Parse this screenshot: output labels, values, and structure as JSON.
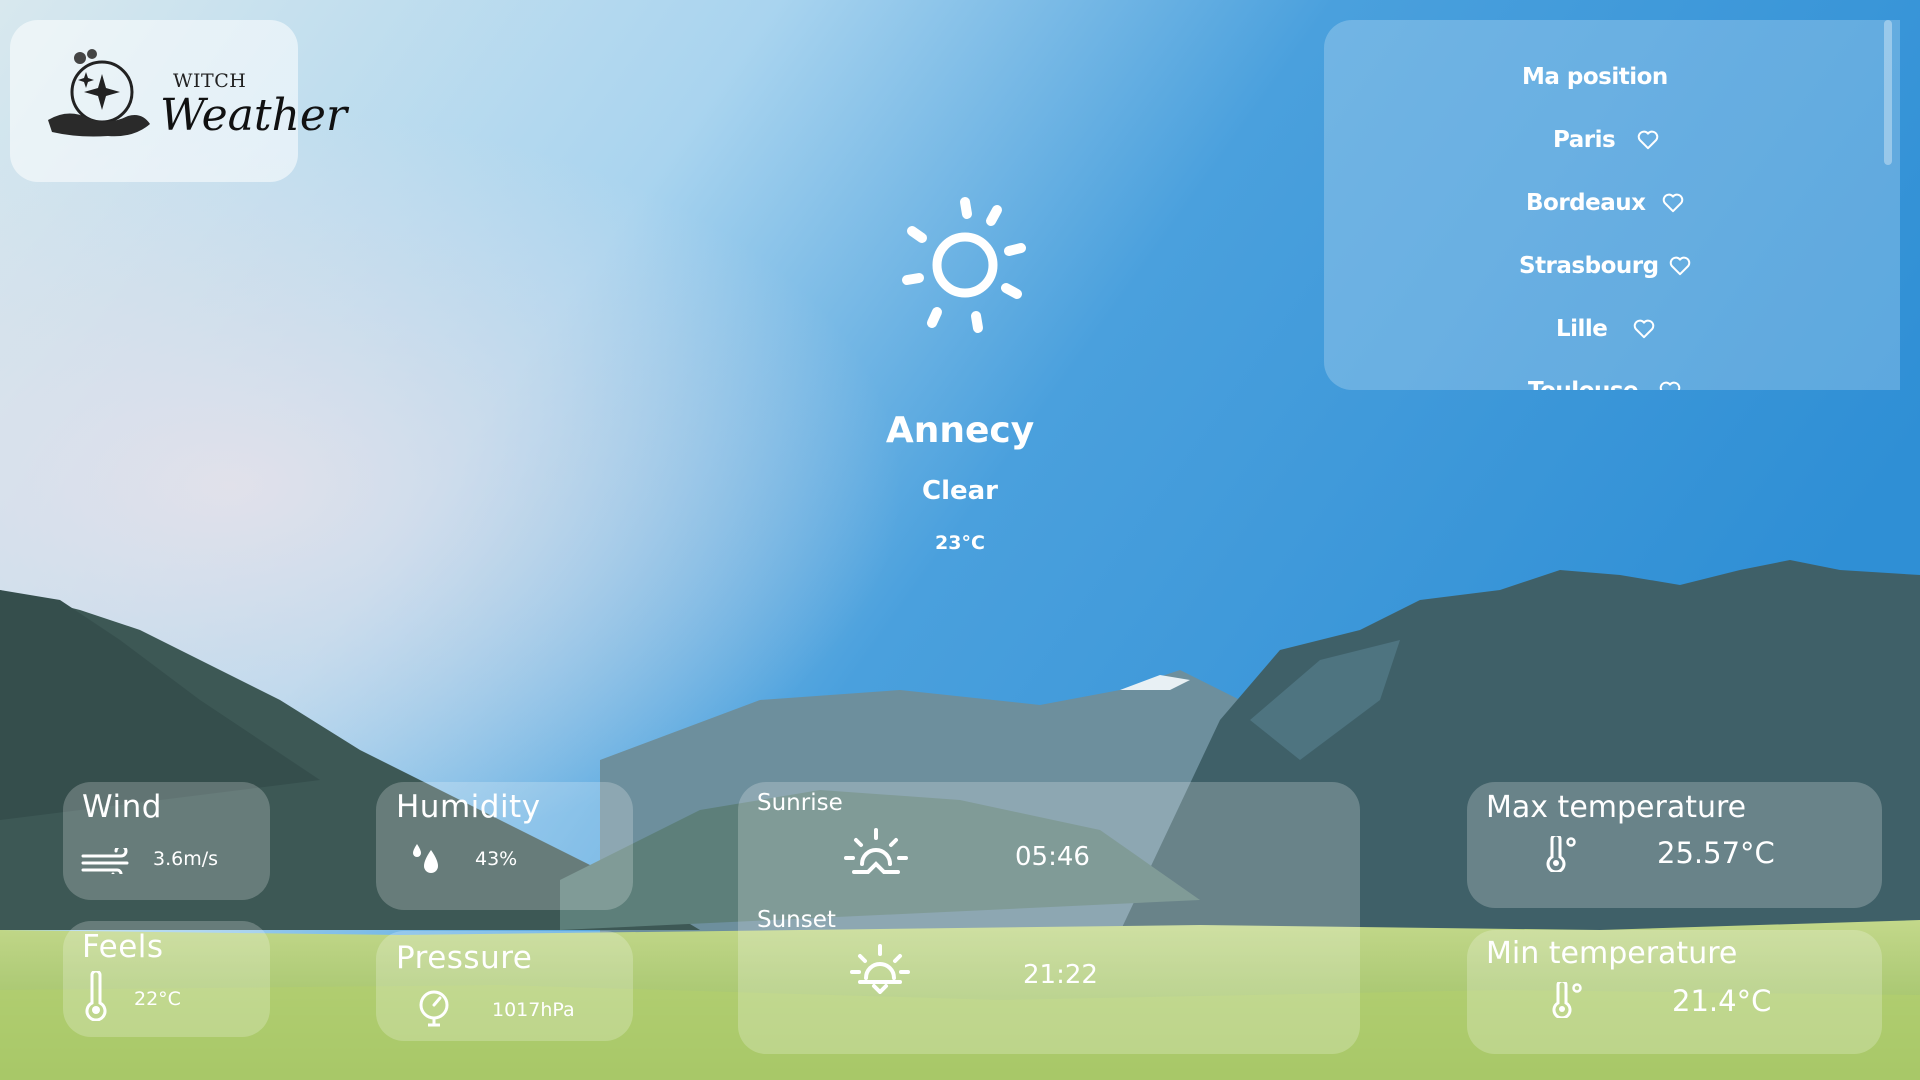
{
  "app": {
    "logo_top": "WITCH",
    "logo_main": "Weather"
  },
  "cities": {
    "items": [
      {
        "label": "Ma position",
        "favorite": false
      },
      {
        "label": "Paris",
        "favorite": true
      },
      {
        "label": "Bordeaux",
        "favorite": true
      },
      {
        "label": "Strasbourg",
        "favorite": true
      },
      {
        "label": "Lille",
        "favorite": true
      },
      {
        "label": "Toulouse",
        "favorite": true
      }
    ]
  },
  "current": {
    "icon": "sun-icon",
    "city": "Annecy",
    "condition": "Clear",
    "temperature": "23°C"
  },
  "cards": {
    "wind": {
      "title": "Wind",
      "value": "3.6m/s",
      "icon": "wind-icon"
    },
    "feels": {
      "title": "Feels",
      "value": "22°C",
      "icon": "thermometer-icon"
    },
    "humidity": {
      "title": "Humidity",
      "value": "43%",
      "icon": "droplets-icon"
    },
    "pressure": {
      "title": "Pressure",
      "value": "1017hPa",
      "icon": "gauge-icon"
    },
    "sunrise": {
      "title": "Sunrise",
      "value": "05:46",
      "icon": "sunrise-icon"
    },
    "sunset": {
      "title": "Sunset",
      "value": "21:22",
      "icon": "sunset-icon"
    },
    "max_temp": {
      "title": "Max temperature",
      "value": "25.57°C",
      "icon": "thermometer-celsius-icon"
    },
    "min_temp": {
      "title": "Min temperature",
      "value": "21.4°C",
      "icon": "thermometer-celsius-icon"
    }
  },
  "colors": {
    "sky_top": "#b5dcf2",
    "sky_bottom": "#2b8fd6",
    "mountain_dark": "#3d5a5c",
    "meadow": "#a8c86a"
  }
}
